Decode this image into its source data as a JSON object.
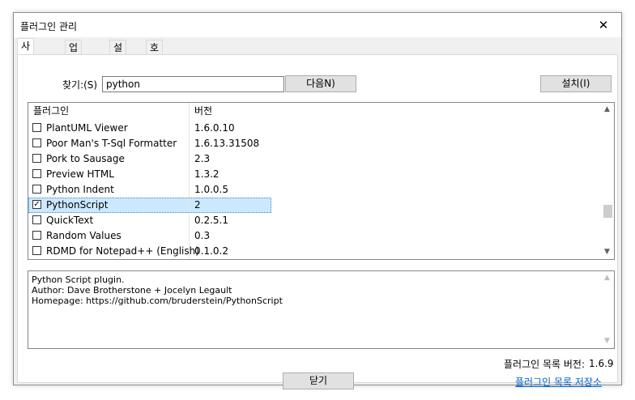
{
  "window": {
    "title": "플러그인 관리",
    "close_symbol": "✕"
  },
  "tabs": [
    "사용 가능",
    "업데이트",
    "설치됨",
    "호환되지 않음"
  ],
  "search": {
    "label": "찾기:(S)",
    "value": "python"
  },
  "buttons": {
    "next": "다음N)",
    "install": "설치(I)",
    "close": "닫기"
  },
  "list": {
    "columns": [
      "플러그인",
      "버전"
    ],
    "rows": [
      {
        "name": "PlantUML Viewer",
        "version": "1.6.0.10",
        "checked": false
      },
      {
        "name": "Poor Man's T-Sql Formatter",
        "version": "1.6.13.31508",
        "checked": false
      },
      {
        "name": "Pork to Sausage",
        "version": "2.3",
        "checked": false
      },
      {
        "name": "Preview HTML",
        "version": "1.3.2",
        "checked": false
      },
      {
        "name": "Python Indent",
        "version": "1.0.0.5",
        "checked": false
      },
      {
        "name": "PythonScript",
        "version": "2",
        "checked": true
      },
      {
        "name": "QuickText",
        "version": "0.2.5.1",
        "checked": false
      },
      {
        "name": "Random Values",
        "version": "0.3",
        "checked": false
      },
      {
        "name": "RDMD for Notepad++ (English)",
        "version": "0.1.0.2",
        "checked": false
      }
    ],
    "selected_index": 5
  },
  "description": [
    "Python Script plugin.",
    "Author: Dave Brotherstone + Jocelyn Legault",
    "Homepage: https://github.com/bruderstein/PythonScript"
  ],
  "footer": {
    "version_label": "플러그인 목록 버전:",
    "version_value": "1.6.9",
    "repo_link": "플러그인 목록 저장소"
  },
  "icons": {
    "check": "✓",
    "scroll_up": "▲",
    "scroll_down": "▼"
  }
}
